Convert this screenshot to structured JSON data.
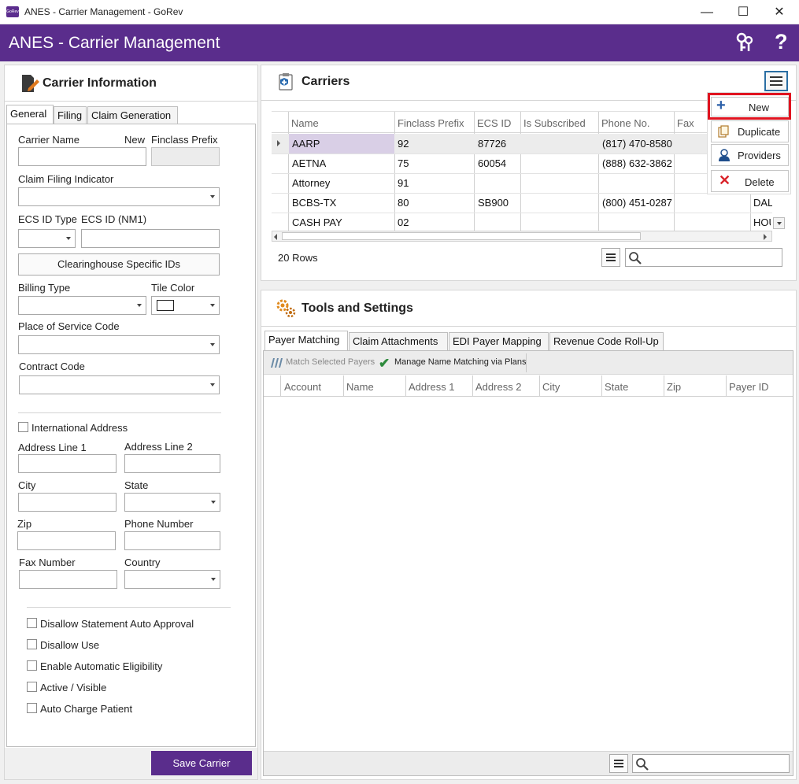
{
  "window": {
    "title": "ANES - Carrier Management - GoRev",
    "app_icon_text": "GoRev",
    "minimize_glyph": "—",
    "maximize_glyph": "☐",
    "close_glyph": "✕"
  },
  "header": {
    "title": "ANES - Carrier Management",
    "keys_icon": "keys-icon",
    "help_glyph": "?"
  },
  "carrier_info": {
    "title": "Carrier Information",
    "tabs": [
      "General",
      "Filing",
      "Claim Generation"
    ],
    "active_tab": "General",
    "fields": {
      "carrier_name": "Carrier Name",
      "new_label": "New",
      "finclass_prefix": "Finclass Prefix",
      "claim_filing_indicator": "Claim Filing Indicator",
      "ecs_id_type": "ECS ID Type",
      "ecs_id_nm1": "ECS ID (NM1)",
      "clearinghouse_button": "Clearinghouse Specific IDs",
      "billing_type": "Billing Type",
      "tile_color": "Tile Color",
      "place_of_service_code": "Place of Service Code",
      "contract_code": "Contract Code",
      "international_address": "International Address",
      "address_line_1": "Address Line 1",
      "address_line_2": "Address Line 2",
      "city": "City",
      "state": "State",
      "zip": "Zip",
      "phone_number": "Phone Number",
      "fax_number": "Fax Number",
      "country": "Country"
    },
    "checkboxes": [
      "Disallow Statement Auto Approval",
      "Disallow Use",
      "Enable Automatic Eligibility",
      "Active / Visible",
      "Auto Charge Patient"
    ],
    "save_button": "Save Carrier"
  },
  "carriers": {
    "title": "Carriers",
    "columns": [
      "Name",
      "Finclass Prefix",
      "ECS ID",
      "Is Subscribed",
      "Phone No.",
      "Fax"
    ],
    "rows": [
      {
        "name": "AARP",
        "prefix": "92",
        "ecs": "87726",
        "subscribed": "",
        "phone": "(817) 470-8580",
        "fax": "",
        "city": ""
      },
      {
        "name": "AETNA",
        "prefix": "75",
        "ecs": "60054",
        "subscribed": "",
        "phone": "(888) 632-3862",
        "fax": "",
        "city": ""
      },
      {
        "name": "Attorney",
        "prefix": "91",
        "ecs": "",
        "subscribed": "",
        "phone": "",
        "fax": "",
        "city": ""
      },
      {
        "name": "BCBS-TX",
        "prefix": "80",
        "ecs": "SB900",
        "subscribed": "",
        "phone": "(800) 451-0287",
        "fax": "",
        "city": "DAL"
      },
      {
        "name": "CASH PAY",
        "prefix": "02",
        "ecs": "",
        "subscribed": "",
        "phone": "",
        "fax": "",
        "city": "HOU"
      }
    ],
    "row_count": "20 Rows",
    "menu": {
      "new": "New",
      "duplicate": "Duplicate",
      "providers": "Providers",
      "delete": "Delete"
    },
    "highlight_color": "#e0131f"
  },
  "tools": {
    "title": "Tools and Settings",
    "tabs": [
      "Payer Matching",
      "Claim Attachments",
      "EDI Payer Mapping",
      "Revenue Code Roll-Up"
    ],
    "active_tab": "Payer Matching",
    "toolbar": {
      "match_selected": "Match Selected Payers",
      "manage_name_matching": "Manage Name Matching via Plans"
    },
    "columns": [
      "Account",
      "Name",
      "Address 1",
      "Address 2",
      "City",
      "State",
      "Zip",
      "Payer ID"
    ]
  },
  "colors": {
    "brand_purple": "#5a2d8c",
    "selected_row": "#d9cfe6"
  }
}
